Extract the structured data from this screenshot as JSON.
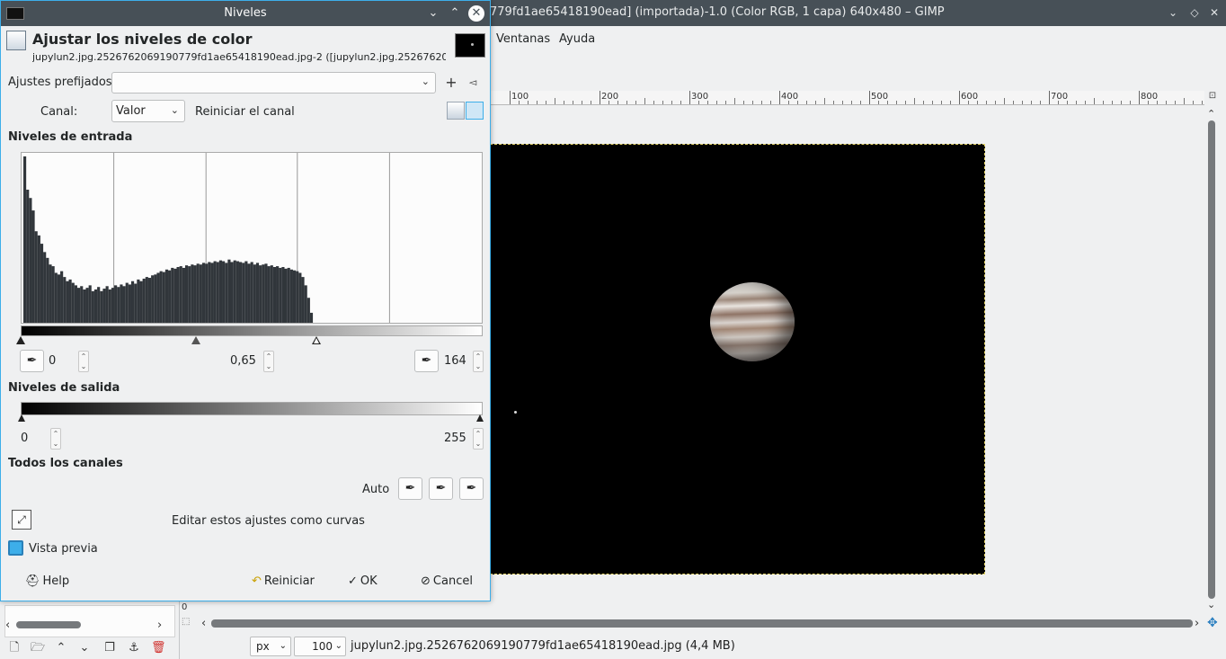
{
  "gimp": {
    "window_title": "779fd1ae65418190ead] (importada)-1.0 (Color RGB, 1 capa) 640x480 – GIMP",
    "menu": [
      "Ventanas",
      "Ayuda"
    ],
    "ruler_labels": [
      "100",
      "200",
      "300",
      "400",
      "500",
      "600",
      "700",
      "800"
    ],
    "status": {
      "unit": "px",
      "zoom": "100 %",
      "file_info": "jupylun2.jpg.2526762069190779fd1ae65418190ead.jpg (4,4 MB)",
      "origin": "0"
    }
  },
  "dialog": {
    "title": "Niveles",
    "header_title": "Ajustar los niveles de color",
    "header_subtitle": "jupylun2.jpg.2526762069190779fd1ae65418190ead.jpg-2 ([jupylun2.jpg.2526762069190...",
    "presets_label": "Ajustes prefijados:",
    "presets_value": "",
    "channel_label": "Canal:",
    "channel_value": "Valor",
    "reset_channel": "Reiniciar el canal",
    "input_section": "Niveles de entrada",
    "input_low": "0",
    "input_gamma": "0,65",
    "input_high": "164",
    "output_section": "Niveles de salida",
    "output_low": "0",
    "output_high": "255",
    "all_channels_section": "Todos los canales",
    "auto_label": "Auto",
    "edit_curves": "Editar estos ajustes como curvas",
    "preview_label": "Vista previa",
    "preview_checked": true,
    "buttons": {
      "help": "Help",
      "reset": "Reiniciar",
      "ok": "OK",
      "cancel": "Cancel"
    }
  },
  "histogram_data": [
    200,
    160,
    150,
    135,
    110,
    105,
    95,
    85,
    78,
    70,
    68,
    60,
    58,
    62,
    55,
    50,
    52,
    48,
    45,
    42,
    44,
    40,
    42,
    45,
    38,
    40,
    43,
    38,
    41,
    44,
    40,
    42,
    45,
    43,
    46,
    44,
    48,
    46,
    50,
    47,
    52,
    50,
    53,
    55,
    54,
    57,
    58,
    60,
    62,
    61,
    64,
    63,
    66,
    65,
    67,
    68,
    66,
    69,
    68,
    70,
    69,
    71,
    70,
    72,
    71,
    73,
    72,
    74,
    73,
    75,
    74,
    72,
    76,
    73,
    75,
    74,
    73,
    72,
    74,
    71,
    73,
    70,
    72,
    69,
    70,
    71,
    68,
    69,
    67,
    68,
    66,
    67,
    65,
    66,
    64,
    63,
    62,
    60,
    55,
    45,
    30,
    12
  ]
}
